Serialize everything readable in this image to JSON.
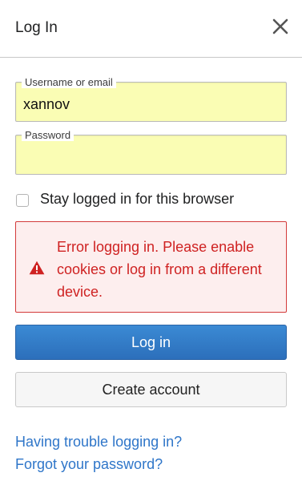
{
  "dialog": {
    "title": "Log In",
    "close_icon": "close-icon"
  },
  "form": {
    "username": {
      "label": "Username or email",
      "value": "xannov"
    },
    "password": {
      "label": "Password",
      "value": ""
    },
    "remember": {
      "label": "Stay logged in for this browser",
      "checked": false
    },
    "error": {
      "icon": "warning-icon",
      "message": "Error logging in. Please enable cookies or log in from a different device."
    },
    "login_button": "Log in",
    "create_account_button": "Create account"
  },
  "links": {
    "trouble": "Having trouble logging in?",
    "forgot": "Forgot your password?"
  },
  "colors": {
    "accent": "#2f76c9",
    "error": "#cf2222",
    "autofill_bg": "#fafdb4"
  }
}
